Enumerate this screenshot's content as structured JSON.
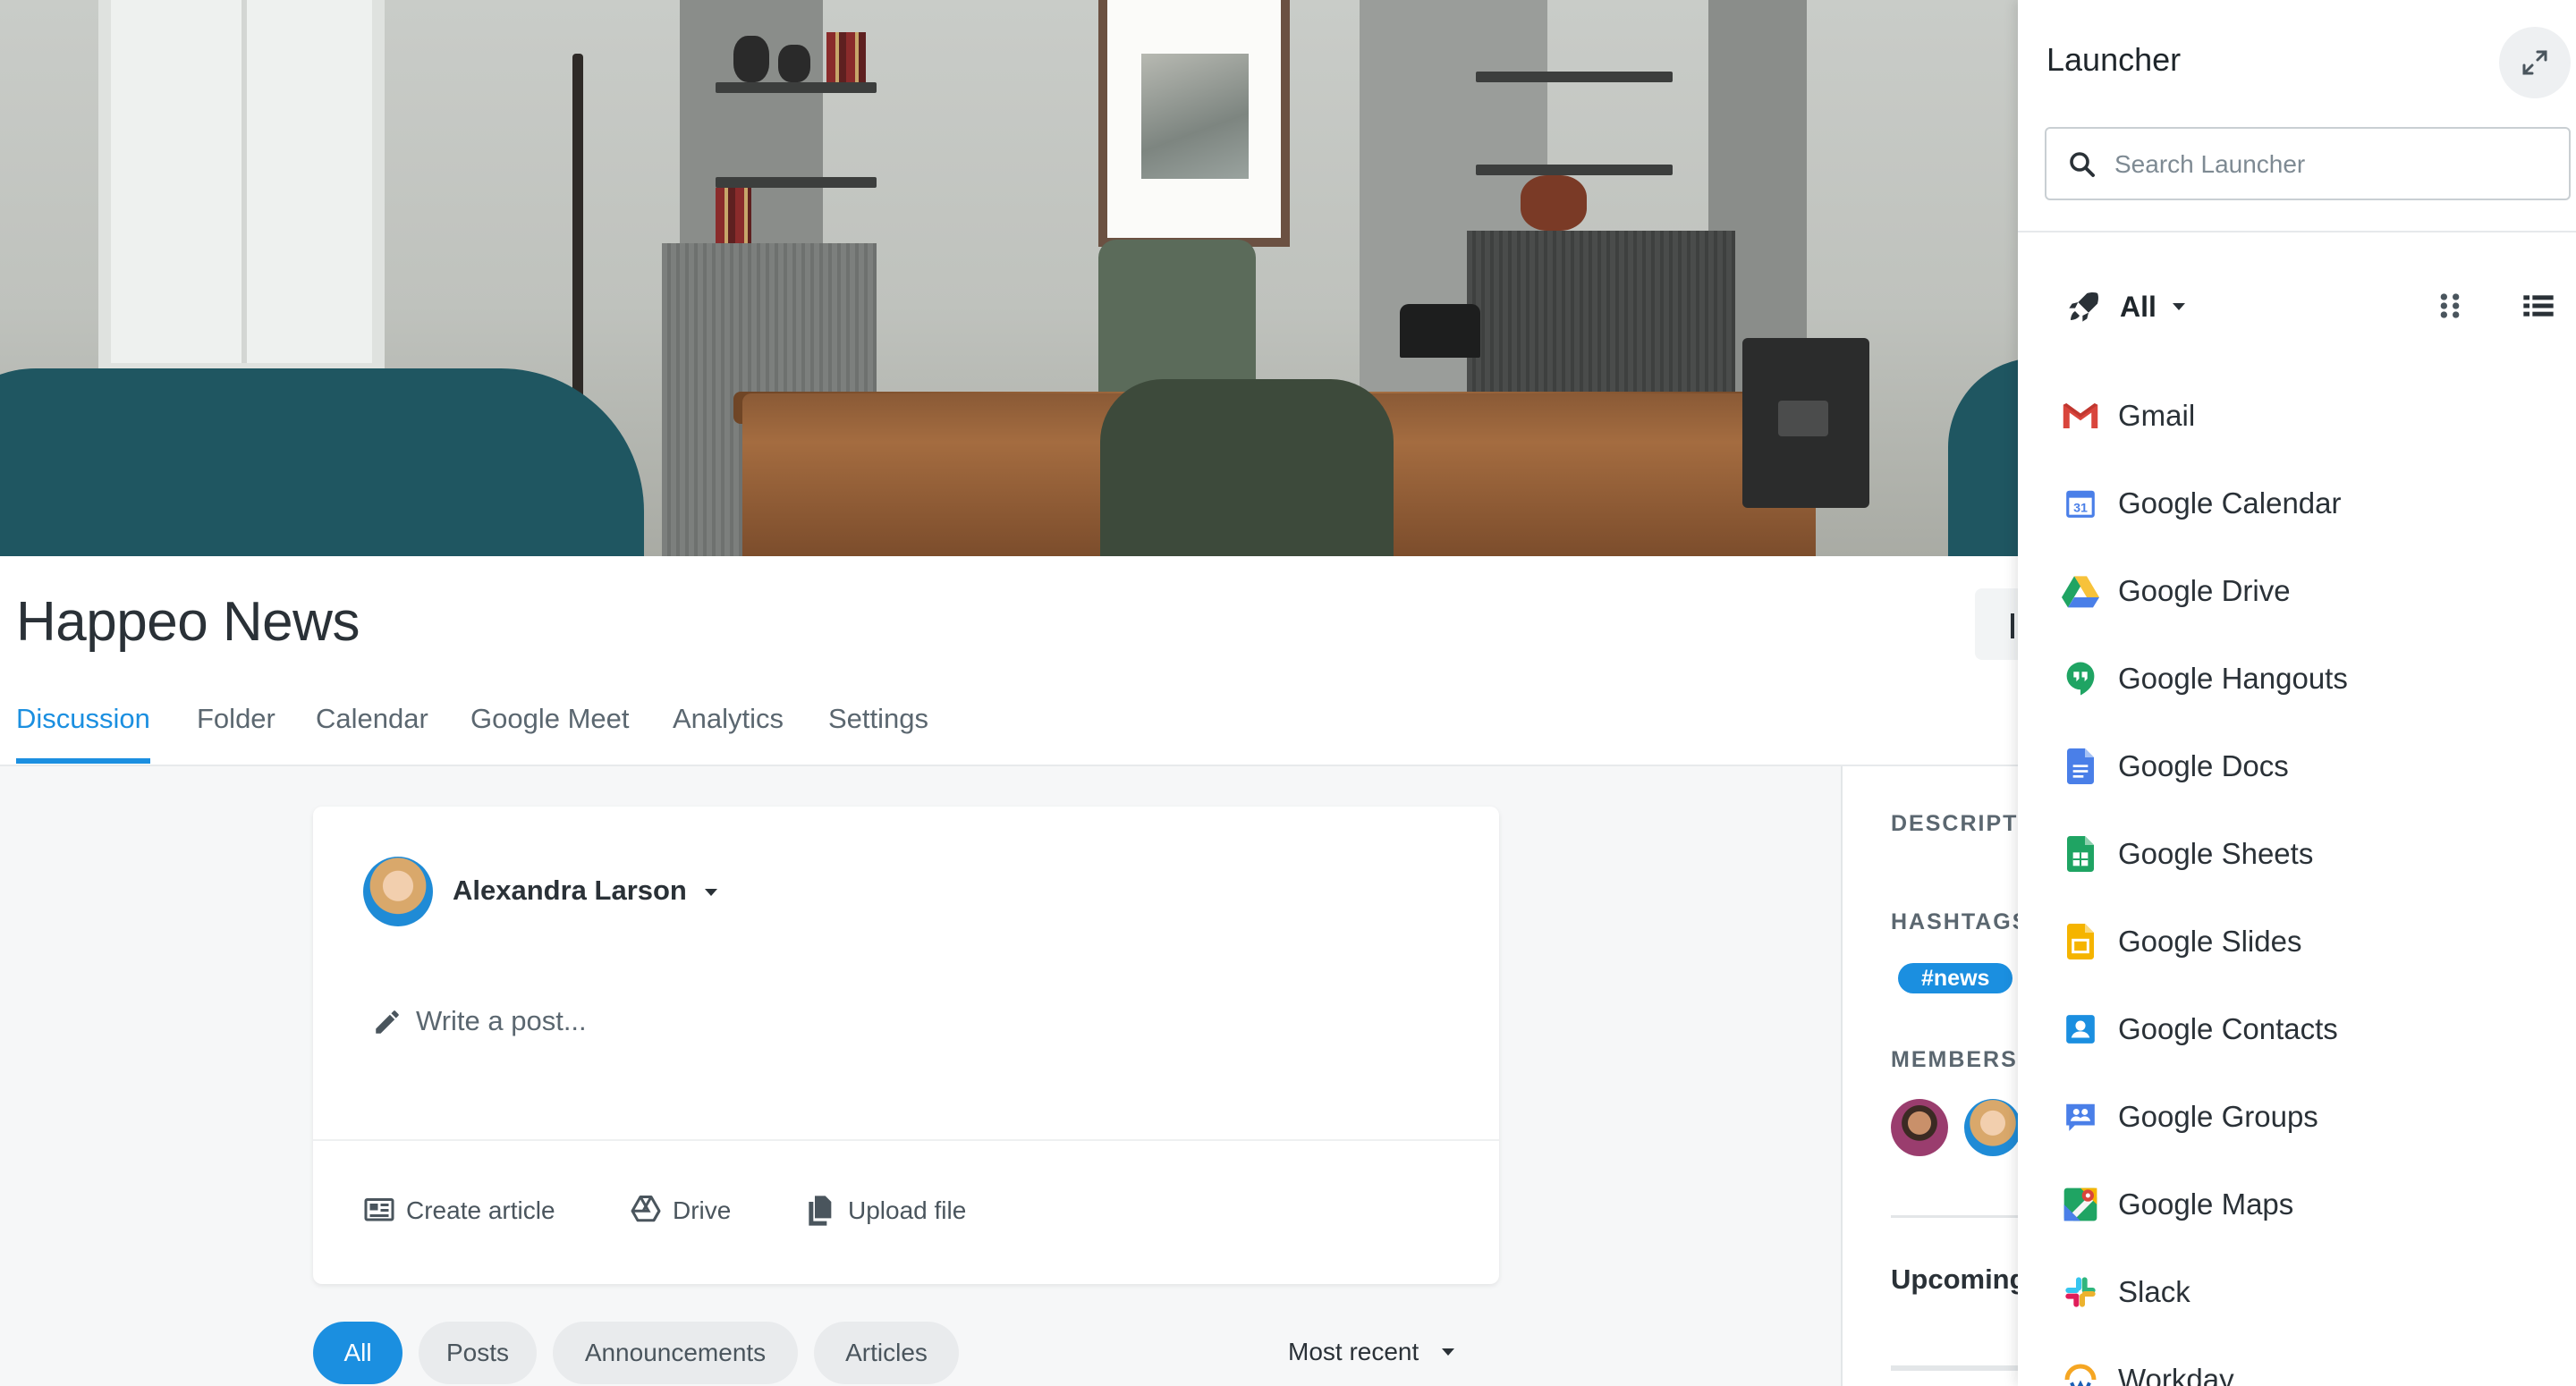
{
  "page": {
    "title": "Happeo News",
    "tabs": [
      {
        "label": "Discussion",
        "active": true
      },
      {
        "label": "Folder"
      },
      {
        "label": "Calendar"
      },
      {
        "label": "Google Meet"
      },
      {
        "label": "Analytics"
      },
      {
        "label": "Settings"
      }
    ]
  },
  "composer": {
    "author": "Alexandra Larson",
    "placeholder": "Write a post...",
    "actions": [
      {
        "label": "Create article",
        "icon": "article-icon"
      },
      {
        "label": "Drive",
        "icon": "drive-icon"
      },
      {
        "label": "Upload file",
        "icon": "upload-file-icon"
      }
    ]
  },
  "feed_filters": {
    "chips": [
      {
        "label": "All",
        "active": true
      },
      {
        "label": "Posts"
      },
      {
        "label": "Announcements"
      },
      {
        "label": "Articles"
      }
    ],
    "sort_label": "Most recent"
  },
  "sidebar": {
    "description_label": "DESCRIPTI",
    "hashtags_label": "HASHTAGS",
    "hashtag": "#news",
    "members_label": "MEMBERS",
    "upcoming_label": "Upcoming"
  },
  "launcher": {
    "title": "Launcher",
    "search_placeholder": "Search Launcher",
    "filter_label": "All",
    "apps": [
      {
        "label": "Gmail",
        "icon": "gmail-icon"
      },
      {
        "label": "Google Calendar",
        "icon": "google-calendar-icon",
        "badge": "31"
      },
      {
        "label": "Google Drive",
        "icon": "google-drive-icon"
      },
      {
        "label": "Google Hangouts",
        "icon": "google-hangouts-icon"
      },
      {
        "label": "Google Docs",
        "icon": "google-docs-icon"
      },
      {
        "label": "Google Sheets",
        "icon": "google-sheets-icon"
      },
      {
        "label": "Google Slides",
        "icon": "google-slides-icon"
      },
      {
        "label": "Google Contacts",
        "icon": "google-contacts-icon"
      },
      {
        "label": "Google Groups",
        "icon": "google-groups-icon"
      },
      {
        "label": "Google Maps",
        "icon": "google-maps-icon"
      },
      {
        "label": "Slack",
        "icon": "slack-icon"
      },
      {
        "label": "Workday",
        "icon": "workday-icon"
      }
    ]
  },
  "colors": {
    "accent": "#1b8fe0",
    "text": "#2a3137",
    "muted": "#5b6770",
    "background": "#f6f7f8"
  }
}
